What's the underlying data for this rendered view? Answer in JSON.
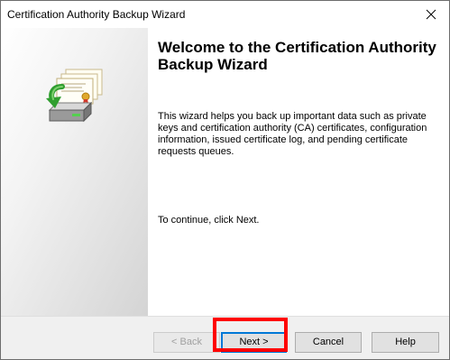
{
  "window": {
    "title": "Certification Authority Backup Wizard"
  },
  "icons": {
    "close": "close-icon",
    "wizard_art": "certificate-backup-icon"
  },
  "main": {
    "heading": "Welcome to the Certification Authority Backup Wizard",
    "description": "This wizard helps you back up important data such as private keys and certification authority (CA) certificates, configuration information, issued certificate log, and pending certificate requests queues.",
    "continue_text": "To continue, click Next."
  },
  "buttons": {
    "back": "< Back",
    "next": "Next >",
    "cancel": "Cancel",
    "help": "Help"
  },
  "colors": {
    "highlight": "#ff0000",
    "focus": "#0078d7"
  }
}
